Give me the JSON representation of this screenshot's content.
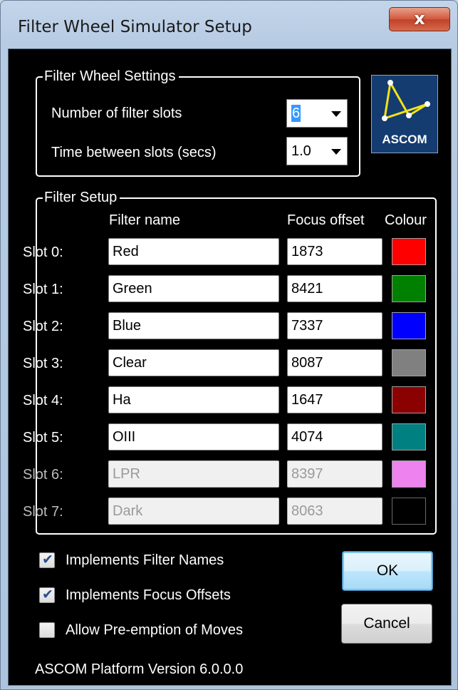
{
  "window": {
    "title": "Filter Wheel Simulator Setup",
    "close_glyph": "x"
  },
  "wheel_settings": {
    "group_title": "Filter Wheel Settings",
    "num_slots_label": "Number of filter slots",
    "num_slots_value": "6",
    "time_label": "Time between slots (secs)",
    "time_value": "1.0"
  },
  "logo": {
    "text": "ASCOM",
    "icon": "ascom-logo"
  },
  "filter_setup": {
    "group_title": "Filter Setup",
    "headers": {
      "name": "Filter name",
      "offset": "Focus offset",
      "colour": "Colour"
    },
    "slots": [
      {
        "label": "Slot 0:",
        "name": "Red",
        "offset": "1873",
        "colour": "#ff0000",
        "enabled": true
      },
      {
        "label": "Slot 1:",
        "name": "Green",
        "offset": "8421",
        "colour": "#008000",
        "enabled": true
      },
      {
        "label": "Slot 2:",
        "name": "Blue",
        "offset": "7337",
        "colour": "#0000ff",
        "enabled": true
      },
      {
        "label": "Slot 3:",
        "name": "Clear",
        "offset": "8087",
        "colour": "#808080",
        "enabled": true
      },
      {
        "label": "Slot 4:",
        "name": "Ha",
        "offset": "1647",
        "colour": "#8b0000",
        "enabled": true
      },
      {
        "label": "Slot 5:",
        "name": "OIII",
        "offset": "4074",
        "colour": "#008080",
        "enabled": true
      },
      {
        "label": "Slot 6:",
        "name": "LPR",
        "offset": "8397",
        "colour": "#ee82ee",
        "enabled": false
      },
      {
        "label": "Slot 7:",
        "name": "Dark",
        "offset": "8063",
        "colour": "#000000",
        "enabled": false
      }
    ]
  },
  "options": [
    {
      "label": "Implements Filter Names",
      "checked": true
    },
    {
      "label": "Implements Focus Offsets",
      "checked": true
    },
    {
      "label": "Allow Pre-emption of Moves",
      "checked": false
    }
  ],
  "buttons": {
    "ok": "OK",
    "cancel": "Cancel"
  },
  "footer": {
    "version": "ASCOM Platform Version 6.0.0.0"
  }
}
